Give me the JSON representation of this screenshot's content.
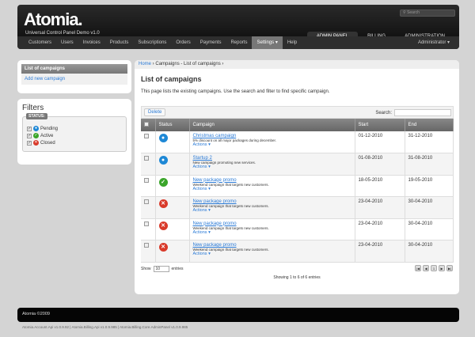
{
  "header": {
    "logo": "Atomia.",
    "subtitle": "Universal Control Panel Demo v1.0",
    "search_placeholder": "Search",
    "tabs": [
      "ADMIN PANEL",
      "BILLING",
      "ADMINISTRATION"
    ]
  },
  "nav": {
    "items": [
      "Customers",
      "Users",
      "Invoices",
      "Products",
      "Subscriptions",
      "Orders",
      "Payments",
      "Reports",
      "Settings ▾",
      "Help"
    ],
    "user": "Administrator ▾"
  },
  "sidebar": {
    "header": "List of campaigns",
    "link": "Add new campaign",
    "filters_title": "Filters",
    "legend": "STATUS:",
    "filters": [
      {
        "label": "Pending",
        "color": "#1e88d6"
      },
      {
        "label": "Active",
        "color": "#3aa52a"
      },
      {
        "label": "Closed",
        "color": "#d93a2a"
      }
    ]
  },
  "breadcrumb": {
    "home": "Home",
    "sep": " › ",
    "current": "Campaigns - List of campaigns ›"
  },
  "main": {
    "title": "List of campaigns",
    "description": "This page lists the existing campaigns. Use the search and filter to find specific campaign.",
    "delete": "Delete",
    "search_label": "Search:",
    "columns": [
      "Status",
      "Campaign",
      "Start",
      "End"
    ],
    "rows": [
      {
        "status": "pending",
        "name": "Christmas campaign",
        "desc": "5% discount on all major packages during december.",
        "actions": "Actions ▾",
        "start": "01-12-2010",
        "end": "31-12-2010"
      },
      {
        "status": "pending",
        "name": "Startup 2",
        "desc": "New campaign promoting new services.",
        "actions": "Actions ▾",
        "start": "01-08-2010",
        "end": "31-08-2010"
      },
      {
        "status": "active",
        "name": "New package promo",
        "desc": "Weekend campaign that targets new customers.",
        "actions": "Actions ▾",
        "start": "18-05-2010",
        "end": "19-05-2010"
      },
      {
        "status": "closed",
        "name": "New package promo",
        "desc": "Weekend campaign that targets new customers.",
        "actions": "Actions ▾",
        "start": "23-04-2010",
        "end": "30-04-2010"
      },
      {
        "status": "closed",
        "name": "New package promo",
        "desc": "Weekend campaign that targets new customers.",
        "actions": "Actions ▾",
        "start": "23-04-2010",
        "end": "30-04-2010"
      },
      {
        "status": "closed",
        "name": "New package promo",
        "desc": "Weekend campaign that targets new customers.",
        "actions": "Actions ▾",
        "start": "23-04-2010",
        "end": "30-04-2010"
      }
    ],
    "show": "Show",
    "page_size": "10",
    "entries": "entries",
    "info": "Showing 1 to 6 of 6 entries",
    "current_page": "1"
  },
  "footer": {
    "copyright": "Atomia ©2009",
    "versions": "Atomia.Account.Api v1.0.9.92 | Atomia.Billing.Api v1.0.9.985 | Atomia.Billing.Core.AdminPanel v1.0.9.985"
  }
}
